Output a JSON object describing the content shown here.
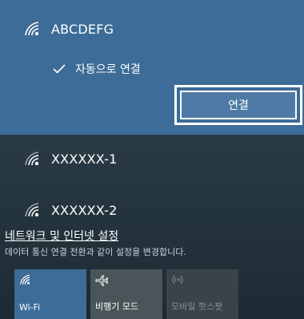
{
  "networks": {
    "selected": {
      "name": "ABCDEFG",
      "auto_connect_label": "자동으로 연결",
      "connect_button": "연결"
    },
    "others": [
      {
        "name": "XXXXXX-1"
      },
      {
        "name": "XXXXXX-2"
      }
    ]
  },
  "settings": {
    "link": "네트워크 및 인터넷 설정",
    "description": "데이터 통신 연결 전환과 같이 설정을 변경합니다."
  },
  "quick_actions": [
    {
      "label": "Wi-Fi",
      "icon": "wifi-icon",
      "state": "on"
    },
    {
      "label": "비행기 모드",
      "icon": "airplane-icon",
      "state": "off"
    },
    {
      "label": "모바일 핫스팟",
      "icon": "hotspot-icon",
      "state": "disabled"
    }
  ],
  "colors": {
    "accent": "#3d6c98",
    "panel_background": "#1f2a33",
    "tile_off": "#4a5559",
    "text": "#ffffff"
  }
}
